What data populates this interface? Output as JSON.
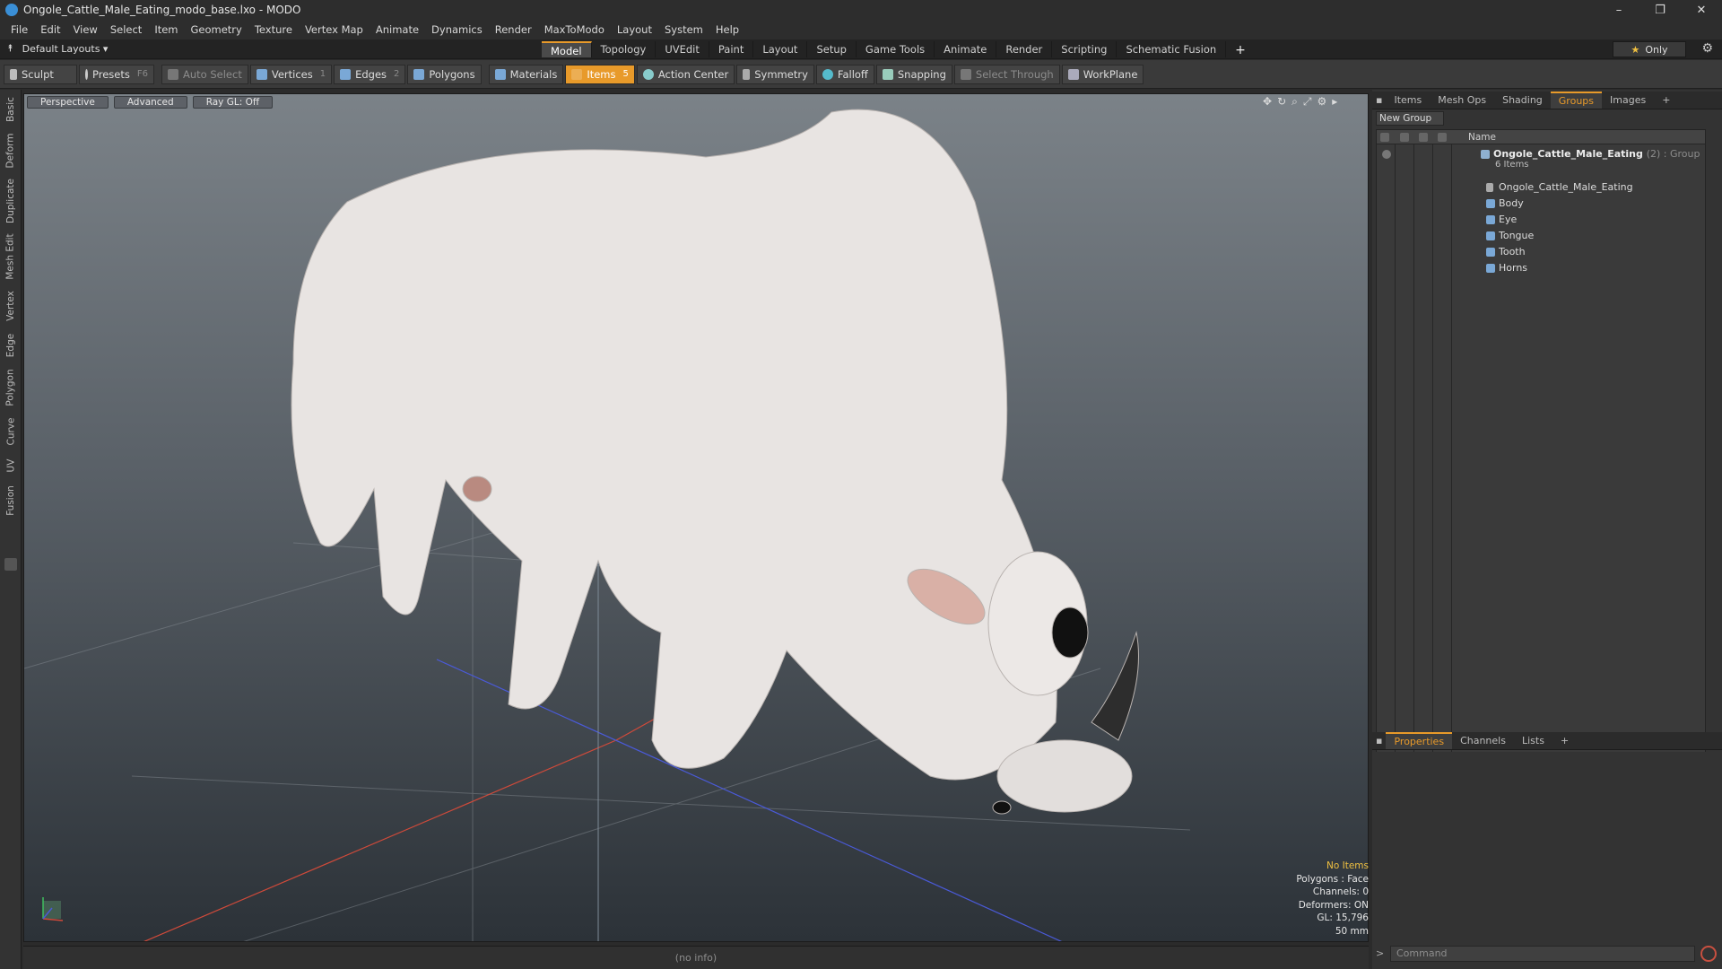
{
  "window": {
    "title": "Ongole_Cattle_Male_Eating_modo_base.lxo - MODO",
    "controls": [
      "–",
      "❐",
      "✕"
    ]
  },
  "menu": [
    "File",
    "Edit",
    "View",
    "Select",
    "Item",
    "Geometry",
    "Texture",
    "Vertex Map",
    "Animate",
    "Dynamics",
    "Render",
    "MaxToModo",
    "Layout",
    "System",
    "Help"
  ],
  "layouts": {
    "label": "Default Layouts ▾"
  },
  "tabs": [
    "Model",
    "Topology",
    "UVEdit",
    "Paint",
    "Layout",
    "Setup",
    "Game Tools",
    "Animate",
    "Render",
    "Scripting",
    "Schematic Fusion"
  ],
  "active_tab": "Model",
  "only_button": {
    "label": "Only"
  },
  "toolbar": {
    "sculpt": "Sculpt",
    "presets": "Presets",
    "presets_key": "F6",
    "auto_select": "Auto Select",
    "vertices": "Vertices",
    "vertices_num": "1",
    "edges": "Edges",
    "edges_num": "2",
    "polygons": "Polygons",
    "materials": "Materials",
    "items": "Items",
    "items_num": "5",
    "action_center": "Action Center",
    "symmetry": "Symmetry",
    "falloff": "Falloff",
    "snapping": "Snapping",
    "select_through": "Select Through",
    "workplane": "WorkPlane"
  },
  "left_tabs": [
    "Basic",
    "Deform",
    "Duplicate",
    "Mesh Edit",
    "Vertex",
    "Edge",
    "Polygon",
    "Curve",
    "UV",
    "Fusion"
  ],
  "viewport": {
    "buttons": [
      "Perspective",
      "Advanced",
      "Ray GL: Off"
    ],
    "info": {
      "selection": "No Items",
      "polygons": "Polygons : Face",
      "channels": "Channels: 0",
      "deformers": "Deformers: ON",
      "gl": "GL: 15,796",
      "focal": "50 mm"
    }
  },
  "status": {
    "text": "(no info)"
  },
  "right_panel": {
    "tabs": [
      "Items",
      "Mesh Ops",
      "Shading",
      "Groups",
      "Images"
    ],
    "active_tab": "Groups",
    "new_group": "New Group",
    "column_name": "Name",
    "group": {
      "name": "Ongole_Cattle_Male_Eating",
      "suffix": "(2) : Group",
      "count": "6 Items"
    },
    "children": [
      "Ongole_Cattle_Male_Eating",
      "Body",
      "Eye",
      "Tongue",
      "Tooth",
      "Horns"
    ],
    "bottom_tabs": [
      "Properties",
      "Channels",
      "Lists"
    ],
    "bottom_active": "Properties",
    "command_placeholder": "Command"
  }
}
